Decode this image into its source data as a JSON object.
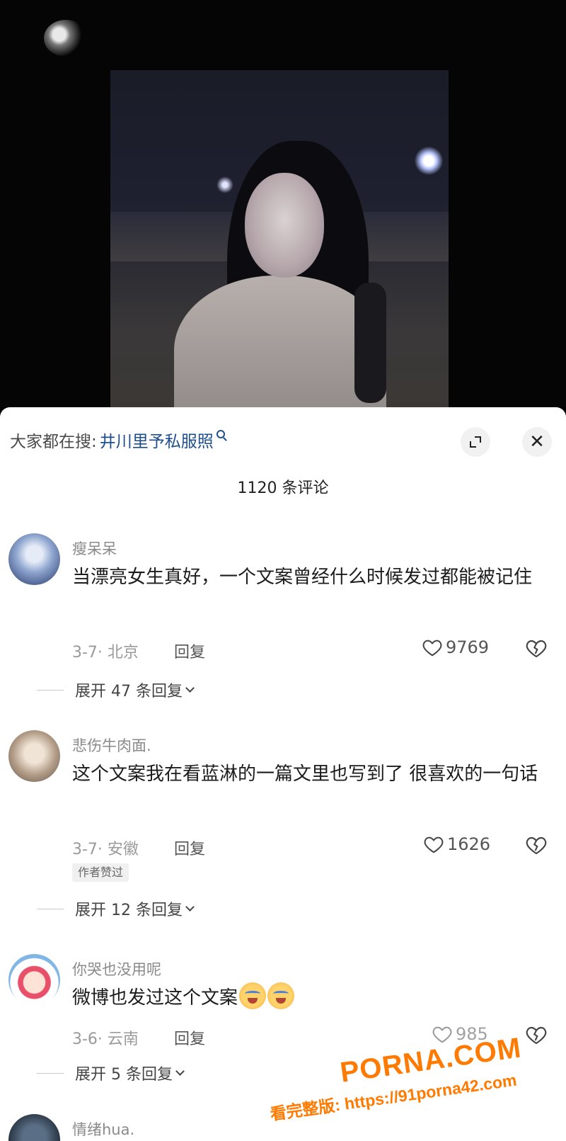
{
  "search": {
    "prefix": "大家都在搜:",
    "query": "井川里予私服照"
  },
  "header": {
    "comment_count": "1120 条评论"
  },
  "comments": [
    {
      "user": "瘦呆呆",
      "text": "当漂亮女生真好，一个文案曾经什么时候发过都能被记住",
      "meta": "3-7· 北京",
      "reply_label": "回复",
      "likes": "9769",
      "expand": "展开 47 条回复"
    },
    {
      "user": "悲伤牛肉面.",
      "text": "这个文案我在看蓝淋的一篇文里也写到了 很喜欢的一句话",
      "meta": "3-7· 安徽",
      "reply_label": "回复",
      "likes": "1626",
      "badge": "作者赞过",
      "expand": "展开 12 条回复"
    },
    {
      "user": "你哭也没用呢",
      "text": "微博也发过这个文案",
      "meta": "3-6· 云南",
      "reply_label": "回复",
      "likes": "985",
      "expand": "展开 5 条回复"
    },
    {
      "user": "情绪hua."
    }
  ],
  "watermark": {
    "brand": "PORNA.COM",
    "url": "看完整版: https://91porna42.com"
  },
  "colors": {
    "link": "#1e4e8c",
    "watermark": "#ff7a00"
  }
}
